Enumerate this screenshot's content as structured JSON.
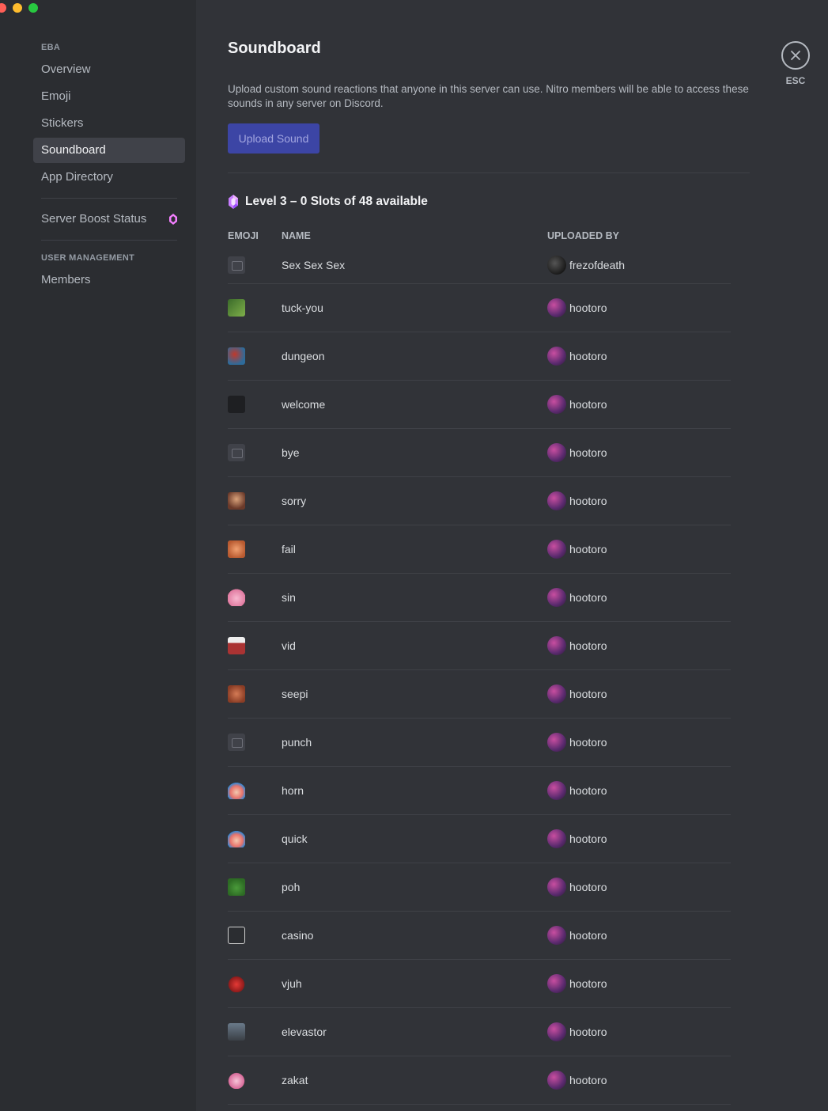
{
  "sidebar": {
    "server_header": "EBA",
    "items": [
      {
        "label": "Overview"
      },
      {
        "label": "Emoji"
      },
      {
        "label": "Stickers"
      },
      {
        "label": "Soundboard",
        "active": true
      },
      {
        "label": "App Directory"
      }
    ],
    "boost_label": "Server Boost Status",
    "user_mgmt_header": "USER MANAGEMENT",
    "members_label": "Members"
  },
  "main": {
    "title": "Soundboard",
    "description": "Upload custom sound reactions that anyone in this server can use. Nitro members will be able to access these sounds in any server on Discord.",
    "upload_button": "Upload Sound",
    "level_text": "Level 3 – 0 Slots of 48 available",
    "table": {
      "headers": {
        "emoji": "EMOJI",
        "name": "NAME",
        "uploaded_by": "UPLOADED BY"
      },
      "rows": [
        {
          "name": "Sex Sex Sex",
          "user": "frezofdeath",
          "emoji": "placeholder-icon"
        },
        {
          "name": "tuck-you",
          "user": "hootoro",
          "emoji": "green-frog-emoji"
        },
        {
          "name": "dungeon",
          "user": "hootoro",
          "emoji": "dungeon-emoji"
        },
        {
          "name": "welcome",
          "user": "hootoro",
          "emoji": "dead-chat-emoji"
        },
        {
          "name": "bye",
          "user": "hootoro",
          "emoji": "placeholder-icon"
        },
        {
          "name": "sorry",
          "user": "hootoro",
          "emoji": "sorry-face-emoji"
        },
        {
          "name": "fail",
          "user": "hootoro",
          "emoji": "fail-face-emoji"
        },
        {
          "name": "sin",
          "user": "hootoro",
          "emoji": "pink-creature-emoji"
        },
        {
          "name": "vid",
          "user": "hootoro",
          "emoji": "vid-emoji"
        },
        {
          "name": "seepi",
          "user": "hootoro",
          "emoji": "seepi-face-emoji"
        },
        {
          "name": "punch",
          "user": "hootoro",
          "emoji": "placeholder-icon"
        },
        {
          "name": "horn",
          "user": "hootoro",
          "emoji": "clown-emoji"
        },
        {
          "name": "quick",
          "user": "hootoro",
          "emoji": "clown-emoji"
        },
        {
          "name": "poh",
          "user": "hootoro",
          "emoji": "pepe-emoji"
        },
        {
          "name": "casino",
          "user": "hootoro",
          "emoji": "f-key-emoji"
        },
        {
          "name": "vjuh",
          "user": "hootoro",
          "emoji": "red-bird-emoji"
        },
        {
          "name": "elevastor",
          "user": "hootoro",
          "emoji": "man-face-emoji"
        },
        {
          "name": "zakat",
          "user": "hootoro",
          "emoji": "pink-bunny-emoji"
        }
      ]
    }
  },
  "close": {
    "label": "ESC"
  },
  "colors": {
    "sidebar_bg": "#2b2d31",
    "main_bg": "#313338",
    "active_item": "#404249",
    "button": "#3c45a5",
    "nitro_pink": "#f47fff"
  }
}
